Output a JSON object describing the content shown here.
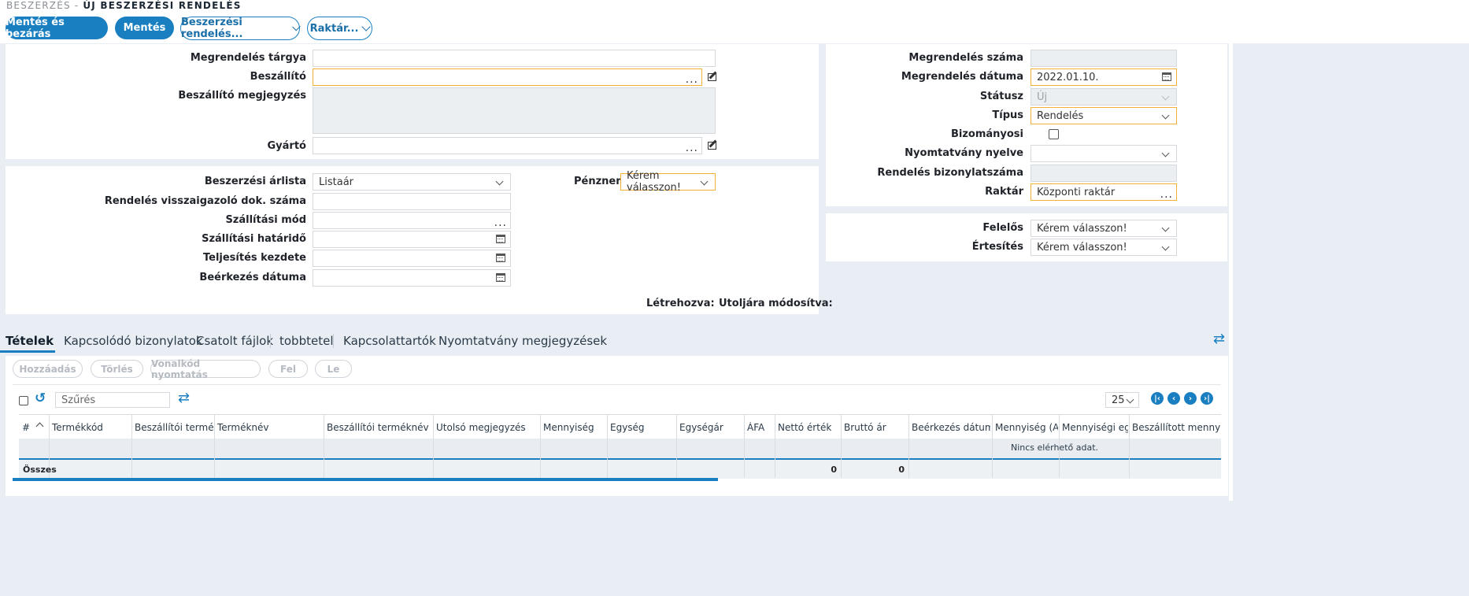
{
  "breadcrumb": {
    "parent": "Beszerzés -",
    "current": "Új beszerzési rendelés"
  },
  "toolbar": {
    "save_close": "Mentés és bezárás",
    "save": "Mentés",
    "purchase_order_menu": "Beszerzési rendelés...",
    "warehouse_menu": "Raktár..."
  },
  "form_left": {
    "subject_label": "Megrendelés tárgya",
    "subject_value": "",
    "supplier_label": "Beszállító",
    "supplier_value": "",
    "supplier_note_label": "Beszállító megjegyzés",
    "manufacturer_label": "Gyártó",
    "manufacturer_value": ""
  },
  "form_mid": {
    "price_list_label": "Beszerzési árlista",
    "price_list_value": "Listaár",
    "confirm_doc_label": "Rendelés visszaigazoló dok. száma",
    "shipping_mode_label": "Szállítási mód",
    "shipping_deadline_label": "Szállítási határidő",
    "fulfillment_start_label": "Teljesítés kezdete",
    "arrival_date_label": "Beérkezés dátuma",
    "currency_label": "Pénznem",
    "currency_value": "Kérem válasszon!",
    "created_label": "Létrehozva:",
    "modified_label": "Utoljára módosítva:"
  },
  "form_right": {
    "order_number_label": "Megrendelés száma",
    "order_date_label": "Megrendelés dátuma",
    "order_date_value": "2022.01.10.",
    "status_label": "Státusz",
    "status_value": "Új",
    "type_label": "Típus",
    "type_value": "Rendelés",
    "consignment_label": "Bizományosi",
    "print_lang_label": "Nyomtatvány nyelve",
    "order_doc_number_label": "Rendelés bizonylatszáma",
    "warehouse_label": "Raktár",
    "warehouse_value": "Központi raktár",
    "responsible_label": "Felelős",
    "responsible_value": "Kérem válasszon!",
    "notify_label": "Értesítés",
    "notify_value": "Kérem válasszon!"
  },
  "tabs": [
    {
      "label": "Tételek"
    },
    {
      "label": "Kapcsolódó bizonylatok"
    },
    {
      "label": "Csatolt fájlok"
    },
    {
      "label": "tobbtetel"
    },
    {
      "label": "Kapcsolattartók"
    },
    {
      "label": "Nyomtatvány megjegyzések"
    }
  ],
  "grid_buttons": {
    "add": "Hozzáadás",
    "delete": "Törlés",
    "barcode": "Vonalkód nyomtatás",
    "up": "Fel",
    "down": "Le"
  },
  "grid": {
    "filter_placeholder": "Szűrés",
    "page_size": "25",
    "columns": [
      "#",
      "Termékkód",
      "Beszállítói termékkód",
      "Terméknév",
      "Beszállítói terméknév",
      "Utolsó megjegyzés",
      "Mennyiség",
      "Egység",
      "Egységár",
      "ÁFA",
      "Nettó érték",
      "Bruttó ár",
      "Beérkezés dátuma",
      "Mennyiség (Alap egység)",
      "Mennyiségi egység",
      "Beszállított mennyiség"
    ],
    "no_data": "Nincs elérhető adat.",
    "total_label": "Összes",
    "total_net": "0",
    "total_gross": "0"
  },
  "colors": {
    "accent": "#1a7fc1",
    "required": "#f2b134",
    "background": "#e8eef3"
  }
}
